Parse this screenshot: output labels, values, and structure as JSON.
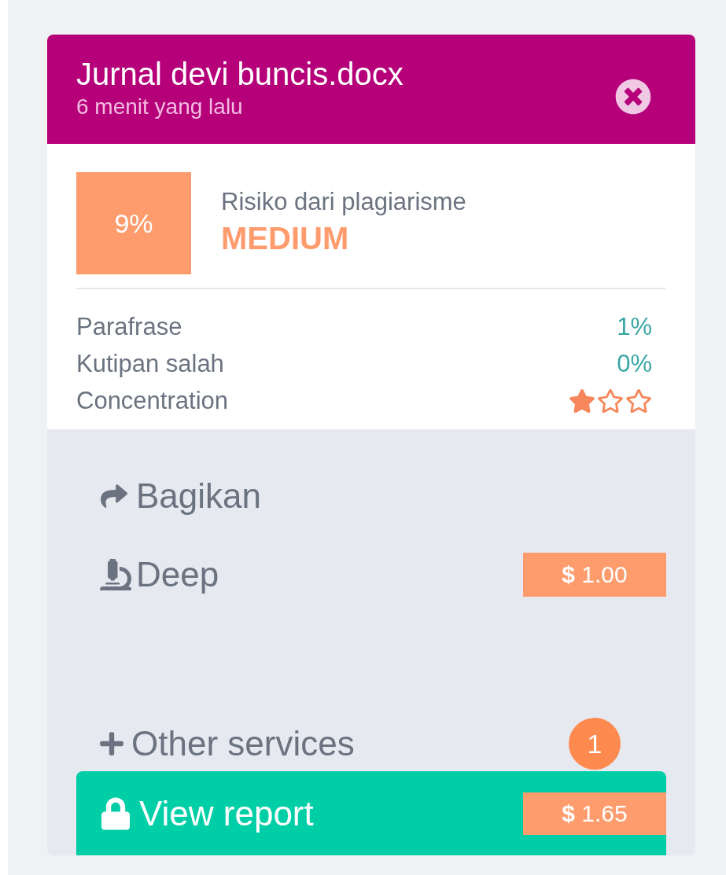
{
  "card": {
    "title": "Jurnal devi buncis.docx",
    "subtitle": "6 menit yang lalu",
    "score": {
      "value": "9%",
      "label": "Risiko dari plagiarisme",
      "risk": "MEDIUM"
    },
    "metrics": [
      {
        "kind": "text",
        "label": "Parafrase",
        "value": "1%"
      },
      {
        "kind": "text",
        "label": "Kutipan salah",
        "value": "0%"
      },
      {
        "kind": "stars",
        "label": "Concentration",
        "stars": 1
      }
    ],
    "actions": [
      {
        "kind": "share",
        "label": "Bagikan"
      },
      {
        "kind": "deep",
        "label": "Deep",
        "price": "**$** 1.00"
      },
      {
        "kind": "other",
        "label": "Other services",
        "badge": "1"
      }
    ],
    "report": {
      "label": "View report",
      "price": "**$** 1.65"
    }
  }
}
